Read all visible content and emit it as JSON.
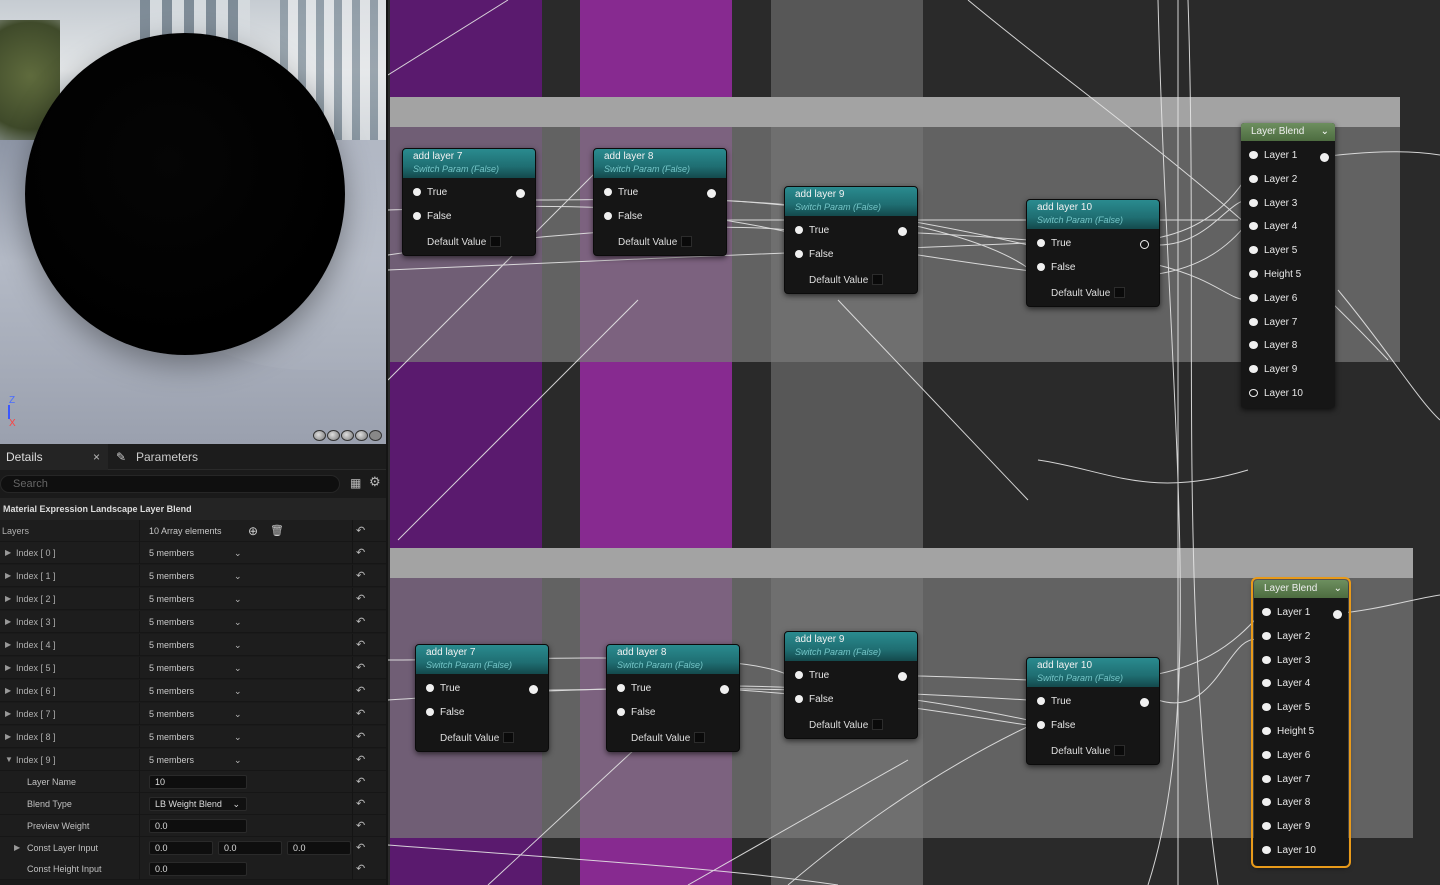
{
  "viewport": {
    "axis_z": "Z",
    "axis_x": "X",
    "preview_buttons": [
      "cylinder-preview-icon",
      "sphere-preview-icon",
      "plane-preview-icon",
      "cube-preview-icon",
      "custom-preview-icon"
    ]
  },
  "tabs": {
    "details": "Details",
    "close": "×",
    "parameters": "Parameters"
  },
  "search": {
    "placeholder": "Search"
  },
  "details": {
    "section_title": "Material Expression Landscape Layer Blend",
    "layers_label": "Layers",
    "layers_value": "10 Array elements",
    "indices": [
      {
        "label": "Index [ 0 ]",
        "value": "5 members"
      },
      {
        "label": "Index [ 1 ]",
        "value": "5 members"
      },
      {
        "label": "Index [ 2 ]",
        "value": "5 members"
      },
      {
        "label": "Index [ 3 ]",
        "value": "5 members"
      },
      {
        "label": "Index [ 4 ]",
        "value": "5 members"
      },
      {
        "label": "Index [ 5 ]",
        "value": "5 members"
      },
      {
        "label": "Index [ 6 ]",
        "value": "5 members"
      },
      {
        "label": "Index [ 7 ]",
        "value": "5 members"
      },
      {
        "label": "Index [ 8 ]",
        "value": "5 members"
      },
      {
        "label": "Index [ 9 ]",
        "value": "5 members"
      }
    ],
    "layer_name_label": "Layer Name",
    "layer_name_value": "10",
    "blend_type_label": "Blend Type",
    "blend_type_value": "LB Weight Blend",
    "preview_weight_label": "Preview Weight",
    "preview_weight_value": "0.0",
    "const_layer_label": "Const Layer Input",
    "const_layer_values": [
      "0.0",
      "0.0",
      "0.0"
    ],
    "const_height_label": "Const Height Input",
    "const_height_value": "0.0"
  },
  "graph": {
    "switch_subtitle": "Switch Param (False)",
    "pin_true": "True",
    "pin_false": "False",
    "default_value": "Default Value",
    "top_nodes": [
      "add layer 7",
      "add layer 8",
      "add layer 9",
      "add layer 10"
    ],
    "bottom_nodes": [
      "add layer 7",
      "add layer 8",
      "add layer 9",
      "add layer 10"
    ],
    "layer_blend_title": "Layer Blend",
    "layer_blend_pins": [
      "Layer 1",
      "Layer 2",
      "Layer 3",
      "Layer 4",
      "Layer 5",
      "Height 5",
      "Layer 6",
      "Layer 7",
      "Layer 8",
      "Layer 9",
      "Layer 10"
    ]
  },
  "colors": {
    "purple_band": "#5a1a6e",
    "magenta_band": "#8a2a92",
    "node_header": "#1f6e72",
    "layer_blend_header": "#5d7d50",
    "selection_outline": "#e89a1a"
  }
}
